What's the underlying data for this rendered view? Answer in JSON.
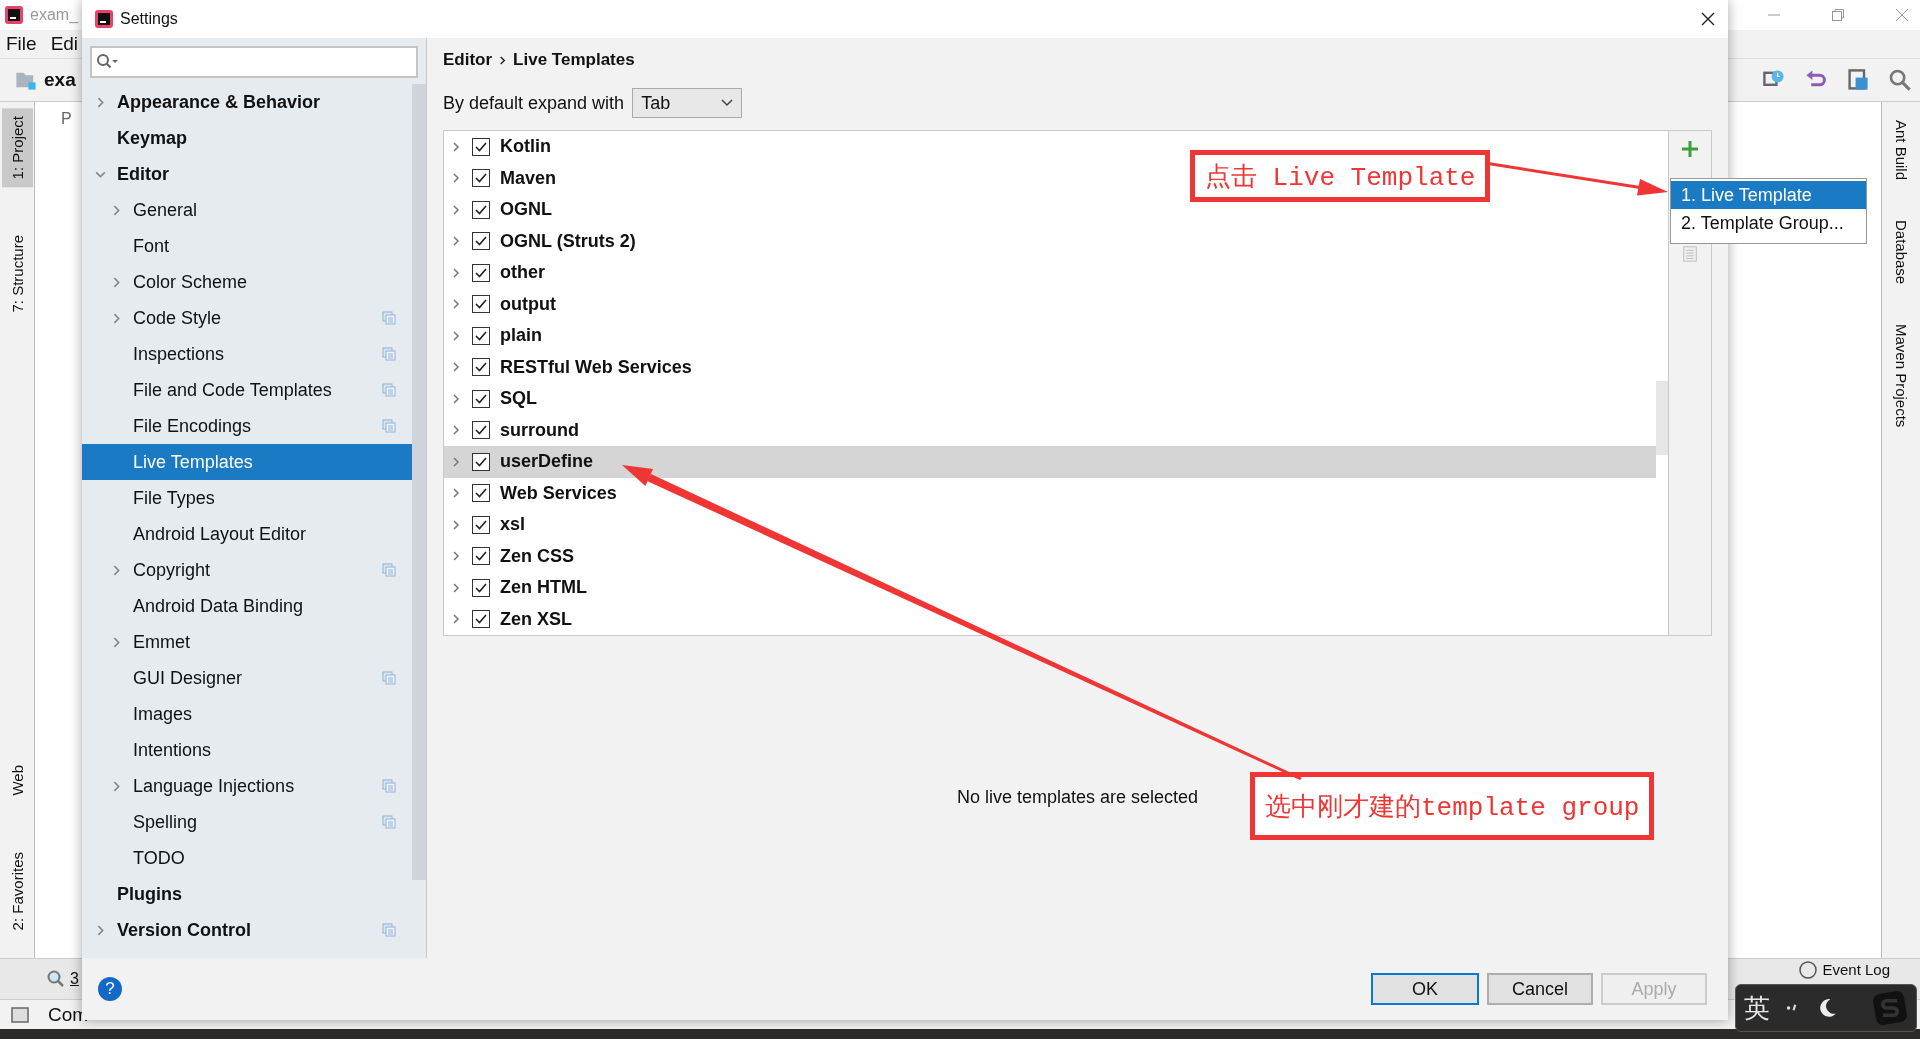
{
  "ide": {
    "title": "exam_",
    "menu": [
      "File",
      "Edi"
    ],
    "project_name": "exa",
    "project_tab": "P",
    "left_tool_tabs": [
      {
        "label": "1: Project",
        "selected": true
      },
      {
        "label": "7: Structure",
        "selected": false
      },
      {
        "label": "Web",
        "selected": false
      },
      {
        "label": "2: Favorites",
        "selected": false
      }
    ],
    "right_tool_tabs": [
      "Ant Build",
      "Database",
      "Maven Projects"
    ],
    "bottom_tab": "3",
    "event_log": "Event Log",
    "status_text": "Com"
  },
  "dialog": {
    "title": "Settings",
    "sidebar": [
      {
        "label": "Appearance & Behavior",
        "expanded": false,
        "project_scope": false,
        "selected": false
      },
      {
        "label": "Keymap",
        "project_scope": false,
        "selected": false
      },
      {
        "label": "Editor",
        "expanded": true,
        "project_scope": false,
        "selected": false,
        "children": [
          {
            "label": "General",
            "expanded": false,
            "project_scope": false,
            "selected": false
          },
          {
            "label": "Font",
            "project_scope": false,
            "selected": false
          },
          {
            "label": "Color Scheme",
            "expanded": false,
            "project_scope": false,
            "selected": false
          },
          {
            "label": "Code Style",
            "expanded": false,
            "project_scope": true,
            "selected": false
          },
          {
            "label": "Inspections",
            "project_scope": true,
            "selected": false
          },
          {
            "label": "File and Code Templates",
            "project_scope": true,
            "selected": false
          },
          {
            "label": "File Encodings",
            "project_scope": true,
            "selected": false
          },
          {
            "label": "Live Templates",
            "project_scope": false,
            "selected": true
          },
          {
            "label": "File Types",
            "project_scope": false,
            "selected": false
          },
          {
            "label": "Android Layout Editor",
            "project_scope": false,
            "selected": false
          },
          {
            "label": "Copyright",
            "expanded": false,
            "project_scope": true,
            "selected": false
          },
          {
            "label": "Android Data Binding",
            "project_scope": false,
            "selected": false
          },
          {
            "label": "Emmet",
            "expanded": false,
            "project_scope": false,
            "selected": false
          },
          {
            "label": "GUI Designer",
            "project_scope": true,
            "selected": false
          },
          {
            "label": "Images",
            "project_scope": false,
            "selected": false
          },
          {
            "label": "Intentions",
            "project_scope": false,
            "selected": false
          },
          {
            "label": "Language Injections",
            "expanded": false,
            "project_scope": true,
            "selected": false
          },
          {
            "label": "Spelling",
            "project_scope": true,
            "selected": false
          },
          {
            "label": "TODO",
            "project_scope": false,
            "selected": false
          }
        ]
      },
      {
        "label": "Plugins",
        "project_scope": false,
        "selected": false
      },
      {
        "label": "Version Control",
        "expanded": false,
        "project_scope": true,
        "selected": false
      }
    ],
    "breadcrumb": [
      "Editor",
      "Live Templates"
    ],
    "expand_label": "By default expand with",
    "expand_value": "Tab",
    "groups": [
      {
        "name": "Kotlin",
        "checked": true,
        "selected": false
      },
      {
        "name": "Maven",
        "checked": true,
        "selected": false
      },
      {
        "name": "OGNL",
        "checked": true,
        "selected": false
      },
      {
        "name": "OGNL (Struts 2)",
        "checked": true,
        "selected": false
      },
      {
        "name": "other",
        "checked": true,
        "selected": false
      },
      {
        "name": "output",
        "checked": true,
        "selected": false
      },
      {
        "name": "plain",
        "checked": true,
        "selected": false
      },
      {
        "name": "RESTful Web Services",
        "checked": true,
        "selected": false
      },
      {
        "name": "SQL",
        "checked": true,
        "selected": false
      },
      {
        "name": "surround",
        "checked": true,
        "selected": false
      },
      {
        "name": "userDefine",
        "checked": true,
        "selected": true
      },
      {
        "name": "Web Services",
        "checked": true,
        "selected": false
      },
      {
        "name": "xsl",
        "checked": true,
        "selected": false
      },
      {
        "name": "Zen CSS",
        "checked": true,
        "selected": false
      },
      {
        "name": "Zen HTML",
        "checked": true,
        "selected": false
      },
      {
        "name": "Zen XSL",
        "checked": true,
        "selected": false
      }
    ],
    "add_menu": [
      {
        "label": "1. Live Template",
        "selected": true
      },
      {
        "label": "2. Template Group...",
        "selected": false
      }
    ],
    "empty_message": "No live templates are selected",
    "help": "?",
    "buttons": [
      {
        "label": "OK",
        "kind": "default",
        "disabled": false
      },
      {
        "label": "Cancel",
        "kind": "normal",
        "disabled": false
      },
      {
        "label": "Apply",
        "kind": "normal",
        "disabled": true
      }
    ]
  },
  "annotations": [
    {
      "text": "点击 Live Template"
    },
    {
      "text": "选中刚才建的template group"
    }
  ],
  "ime": {
    "label": "英"
  }
}
